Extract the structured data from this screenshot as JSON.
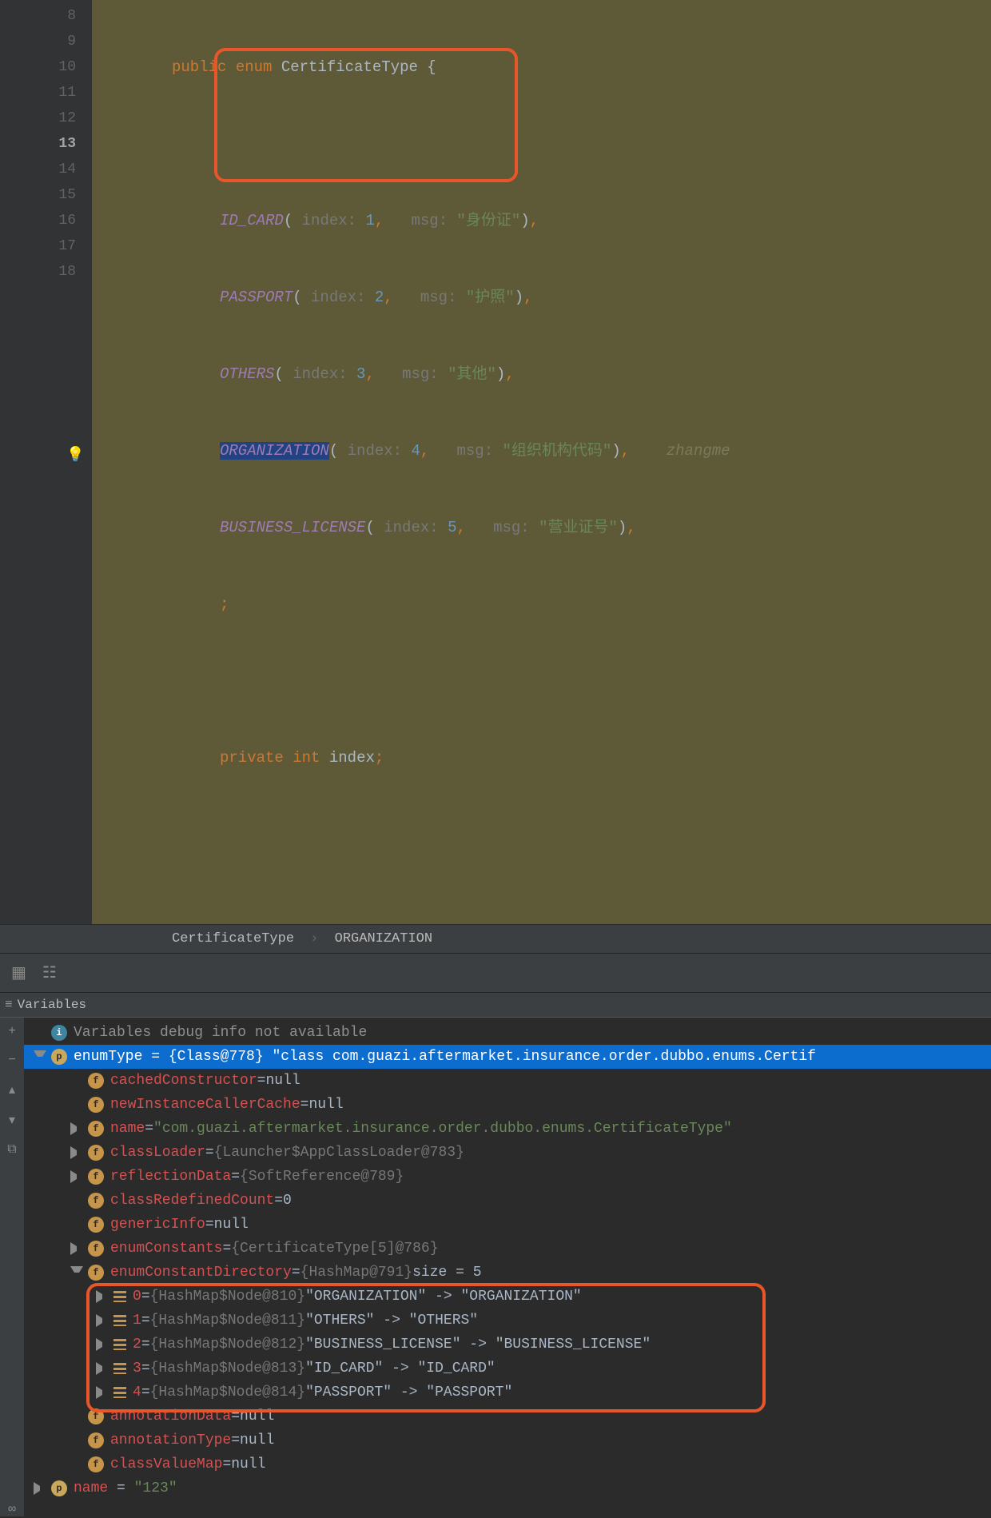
{
  "editor": {
    "gutter": [
      "8",
      "9",
      "10",
      "11",
      "12",
      "13",
      "14",
      "15",
      "16",
      "17",
      "18"
    ],
    "currentLine": 13,
    "header": {
      "kw1": "public",
      "kw2": "enum",
      "cls": "CertificateType",
      "brace": " {"
    },
    "enums": [
      {
        "name": "ID_CARD",
        "idx": "1",
        "msg": "\"身份证\""
      },
      {
        "name": "PASSPORT",
        "idx": "2",
        "msg": "\"护照\""
      },
      {
        "name": "OTHERS",
        "idx": "3",
        "msg": "\"其他\""
      },
      {
        "name": "ORGANIZATION",
        "idx": "4",
        "msg": "\"组织机构代码\"",
        "author": "zhangme"
      },
      {
        "name": "BUSINESS_LICENSE",
        "idx": "5",
        "msg": "\"营业证号\""
      }
    ],
    "paramIndex": " index: ",
    "paramMsg": "msg: ",
    "comma": ",",
    "trailing": ";",
    "field": {
      "kw": "private",
      "type": "int",
      "id": "index",
      "semi": ";"
    },
    "breadcrumb": {
      "a": "CertificateType",
      "b": "ORGANIZATION"
    }
  },
  "panel": {
    "title": "Variables"
  },
  "tree": {
    "info": "Variables debug info not available",
    "root": {
      "name": "enumType",
      "val": "{Class@778} \"class com.guazi.aftermarket.insurance.order.dubbo.enums.Certif"
    },
    "fields": [
      {
        "name": "cachedConstructor",
        "val": "null",
        "expand": "none"
      },
      {
        "name": "newInstanceCallerCache",
        "val": "null",
        "expand": "none"
      },
      {
        "name": "name",
        "val": "\"com.guazi.aftermarket.insurance.order.dubbo.enums.CertificateType\"",
        "str": true,
        "expand": "right"
      },
      {
        "name": "classLoader",
        "val": "{Launcher$AppClassLoader@783}",
        "expand": "right"
      },
      {
        "name": "reflectionData",
        "val": "{SoftReference@789}",
        "expand": "right"
      },
      {
        "name": "classRedefinedCount",
        "val": "0",
        "expand": "none"
      },
      {
        "name": "genericInfo",
        "val": "null",
        "expand": "none"
      },
      {
        "name": "enumConstants",
        "val": "{CertificateType[5]@786}",
        "expand": "right"
      },
      {
        "name": "enumConstantDirectory",
        "val": "{HashMap@791}",
        "tail": "size = 5",
        "expand": "down"
      }
    ],
    "mapEntries": [
      {
        "k": "0",
        "ref": "{HashMap$Node@810}",
        "pair": "\"ORGANIZATION\" -> \"ORGANIZATION\""
      },
      {
        "k": "1",
        "ref": "{HashMap$Node@811}",
        "pair": "\"OTHERS\" -> \"OTHERS\""
      },
      {
        "k": "2",
        "ref": "{HashMap$Node@812}",
        "pair": "\"BUSINESS_LICENSE\" -> \"BUSINESS_LICENSE\""
      },
      {
        "k": "3",
        "ref": "{HashMap$Node@813}",
        "pair": "\"ID_CARD\" -> \"ID_CARD\""
      },
      {
        "k": "4",
        "ref": "{HashMap$Node@814}",
        "pair": "\"PASSPORT\" -> \"PASSPORT\""
      }
    ],
    "tailFields": [
      {
        "name": "annotationData",
        "val": "null"
      },
      {
        "name": "annotationType",
        "val": "null"
      },
      {
        "name": "classValueMap",
        "val": "null"
      }
    ],
    "bottom": {
      "name": "name",
      "val": "\"123\""
    }
  }
}
